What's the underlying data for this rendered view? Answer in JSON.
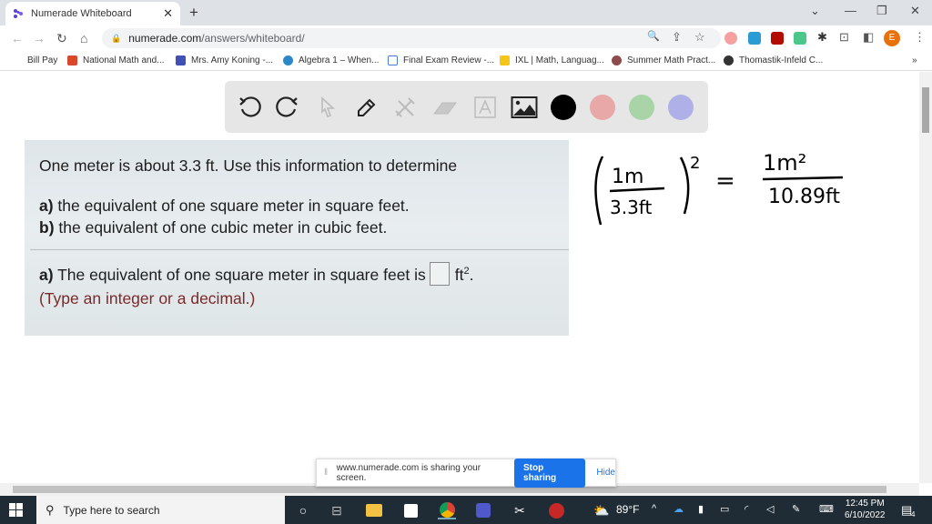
{
  "browser": {
    "tab": {
      "title": "Numerade Whiteboard",
      "close": "✕"
    },
    "new_tab": "+",
    "window_controls": {
      "tabsearch": "⌄",
      "minimize": "—",
      "restore": "❐",
      "close": "✕"
    },
    "nav": {
      "back": "←",
      "forward": "→",
      "reload": "↻",
      "home": "⌂"
    },
    "url": {
      "domain": "numerade.com",
      "path": "/answers/whiteboard/"
    },
    "omnibox_icons": {
      "zoom": "🔍",
      "share": "⇪",
      "bookmark": "☆"
    },
    "profile_initial": "E",
    "menu": "⋮",
    "bookmarks": [
      {
        "label": "Bill Pay",
        "color": ""
      },
      {
        "label": "National Math and...",
        "color": "#d9482b"
      },
      {
        "label": "Mrs. Amy Koning -...",
        "color": "#3f51b5"
      },
      {
        "label": "Algebra 1 – When...",
        "color": "#2a88c9"
      },
      {
        "label": "Final Exam Review -...",
        "color": "#4a7fd6"
      },
      {
        "label": "IXL | Math, Languag...",
        "color": "#f5c518"
      },
      {
        "label": "Summer Math Pract...",
        "color": "#8d4b4b"
      },
      {
        "label": "Thomastik-Infeld C...",
        "color": "#333333"
      }
    ],
    "bookmarks_more": "»"
  },
  "whiteboard": {
    "tools": [
      {
        "name": "undo",
        "enabled": true
      },
      {
        "name": "redo",
        "enabled": true
      },
      {
        "name": "select",
        "enabled": false
      },
      {
        "name": "pen",
        "enabled": true
      },
      {
        "name": "tools",
        "enabled": false
      },
      {
        "name": "eraser",
        "enabled": false
      },
      {
        "name": "text",
        "enabled": false
      },
      {
        "name": "image",
        "enabled": true
      }
    ],
    "colors": [
      "#000000",
      "#e8a8a8",
      "#a8d4a8",
      "#b0b0e8"
    ],
    "problem": {
      "intro": "One meter is about 3.3 ft. Use this information to determine",
      "part_a_label": "a)",
      "part_a": " the equivalent of one square meter in square feet.",
      "part_b_label": "b)",
      "part_b": " the equivalent of one cubic meter in cubic feet.",
      "answer_label": "a)",
      "answer_text": " The equivalent of one square meter in square feet is",
      "answer_unit": "ft",
      "answer_unit_exp": "2",
      "answer_end": ".",
      "answer_value": "",
      "hint": "(Type an integer or a decimal.)"
    },
    "handwriting": {
      "left_numerator": "1m",
      "left_denominator": "3.3ft",
      "exponent": "2",
      "equals": "=",
      "right_numerator": "1m²",
      "right_denominator": "10.89ft"
    }
  },
  "share_bar": {
    "message": "www.numerade.com is sharing your screen.",
    "stop_label": "Stop sharing",
    "hide_label": "Hide"
  },
  "taskbar": {
    "search_placeholder": "Type here to search",
    "weather": "89°F",
    "time": "12:45 PM",
    "date": "6/10/2022",
    "notifications": "4"
  }
}
